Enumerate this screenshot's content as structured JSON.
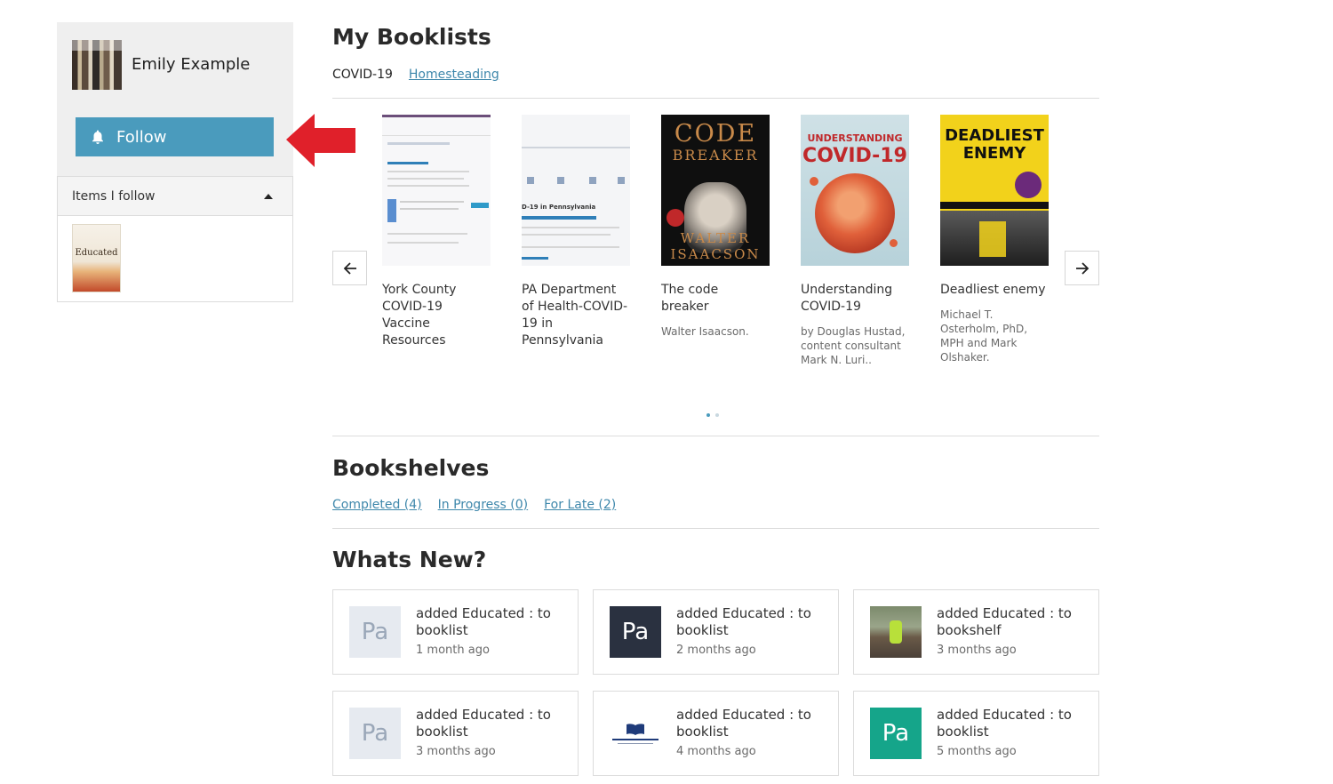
{
  "profile": {
    "name": "Emily Example",
    "follow_label": "Follow"
  },
  "following": {
    "header": "Items I follow",
    "items": [
      {
        "cover_text": "Educated"
      }
    ]
  },
  "booklists": {
    "title": "My Booklists",
    "tabs": [
      {
        "label": "COVID-19",
        "active": true
      },
      {
        "label": "Homesteading",
        "active": false
      }
    ],
    "books": [
      {
        "title": "York County COVID-19 Vaccine Resources",
        "author": ""
      },
      {
        "title": "PA Department of Health-COVID-19 in Pennsylvania",
        "author": "",
        "cover_text": "D-19 in Pennsylvania"
      },
      {
        "title": "The code breaker",
        "author": "Walter Isaacson.",
        "cover_text": [
          "CODE",
          "BREAKER",
          "WALTER",
          "ISAACSON"
        ]
      },
      {
        "title": "Understanding COVID-19",
        "author": "by Douglas Hustad, content consultant Mark N. Luri..",
        "cover_text": [
          "UNDERSTANDING",
          "COVID-19"
        ]
      },
      {
        "title": "Deadliest enemy",
        "author": "Michael T. Osterholm, PhD, MPH and Mark Olshaker.",
        "cover_text": [
          "DEADLIEST",
          "ENEMY"
        ]
      }
    ],
    "pages": 2,
    "current_page": 1
  },
  "bookshelves": {
    "title": "Bookshelves",
    "links": [
      "Completed (4)",
      "In Progress (0)",
      "For Late (2)"
    ]
  },
  "whats_new": {
    "title": "Whats New?",
    "items": [
      {
        "text": "added Educated : to booklist",
        "time": "1 month ago",
        "thumb": "Pa",
        "thumb_style": "light"
      },
      {
        "text": "added Educated : to booklist",
        "time": "2 months ago",
        "thumb": "Pa",
        "thumb_style": "dark"
      },
      {
        "text": "added Educated : to bookshelf",
        "time": "3 months ago",
        "thumb": "",
        "thumb_style": "photo"
      },
      {
        "text": "added Educated : to booklist",
        "time": "3 months ago",
        "thumb": "Pa",
        "thumb_style": "light"
      },
      {
        "text": "added Educated : to booklist",
        "time": "4 months ago",
        "thumb": "",
        "thumb_style": "logo"
      },
      {
        "text": "added Educated : to booklist",
        "time": "5 months ago",
        "thumb": "Pa",
        "thumb_style": "teal"
      }
    ]
  },
  "colors": {
    "accent": "#4a9bbd",
    "link": "#3e87ab",
    "arrow": "#e0202a"
  },
  "icons": {
    "bell": "bell-icon",
    "prev": "arrow-left-icon",
    "next": "arrow-right-icon",
    "collapse": "caret-up-icon",
    "pointer": "red-arrow-icon"
  }
}
